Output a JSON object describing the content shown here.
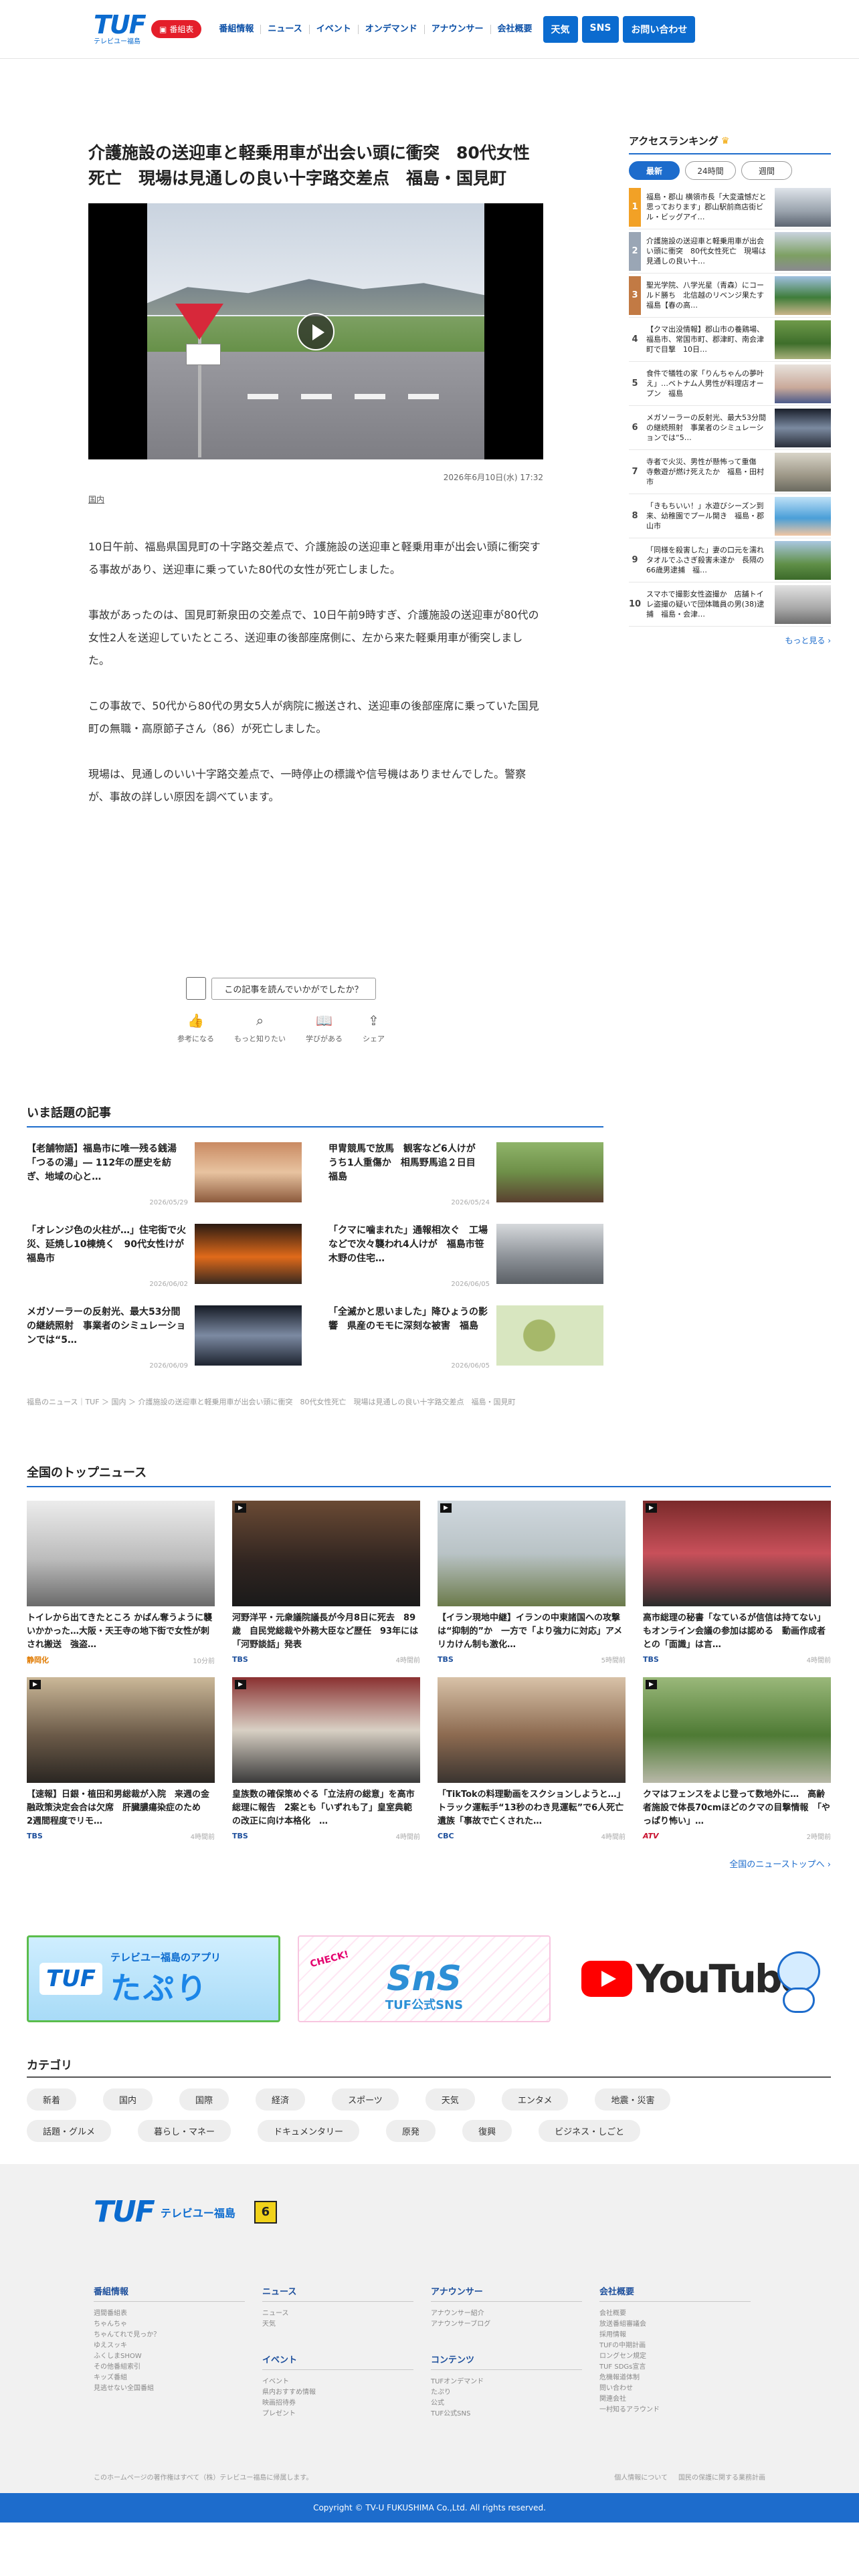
{
  "header": {
    "logo": "TUF",
    "logo_sub": "テレビユー福島",
    "badge": "番組表",
    "nav": [
      "番組情報",
      "ニュース",
      "イベント",
      "オンデマンド",
      "アナウンサー",
      "会社概要"
    ],
    "buttons": [
      "天気",
      "SNS",
      "お問い合わせ"
    ]
  },
  "article": {
    "title": "介護施設の送迎車と軽乗用車が出会い頭に衝突　80代女性死亡　現場は見通しの良い十字路交差点　福島・国見町",
    "date": "2026年6月10日(水) 17:32",
    "tag": "国内",
    "paragraphs": [
      "10日午前、福島県国見町の十字路交差点で、介護施設の送迎車と軽乗用車が出会い頭に衝突する事故があり、送迎車に乗っていた80代の女性が死亡しました。",
      "事故があったのは、国見町新泉田の交差点で、10日午前9時すぎ、介護施設の送迎車が80代の女性2人を送迎していたところ、送迎車の後部座席側に、左から来た軽乗用車が衝突しました。",
      "この事故で、50代から80代の男女5人が病院に搬送され、送迎車の後部座席に乗っていた国見町の無職・高原節子さん（86）が死亡しました。",
      "現場は、見通しのいい十字路交差点で、一時停止の標識や信号機はありませんでした。警察が、事故の詳しい原因を調べています。"
    ]
  },
  "survey": {
    "question": "この記事を読んでいかがでしたか？",
    "reactions": [
      "参考になる",
      "もっと知りたい",
      "学びがある",
      "シェア"
    ]
  },
  "ranking": {
    "heading": "アクセスランキング",
    "tabs": [
      "最新",
      "24時間",
      "週間"
    ],
    "items": [
      {
        "num": "1",
        "text": "福島・郡山 横領市長「大変遺憾だと思っております」郡山駅前商店街ビル・ビッグアイ…"
      },
      {
        "num": "2",
        "text": "介護施設の送迎車と軽乗用車が出会い頭に衝突　80代女性死亡　現場は見通しの良い十…"
      },
      {
        "num": "3",
        "text": "聖光学院、八学光星（青森）にコールド勝ち　北信越のリベンジ果たす　福島【春の高…"
      },
      {
        "num": "4",
        "text": "【クマ出没情報】郡山市の養鶏場、福島市、常国市町、郡津町、南会津町で目撃　10日…"
      },
      {
        "num": "5",
        "text": "食件で犠牲の家「りんちゃんの夢叶え」…ベトナム人男性が料理店オープン　福島"
      },
      {
        "num": "6",
        "text": "メガソーラーの反射光、最大53分間の継続照射　事業者のシミュレーションでは“5…"
      },
      {
        "num": "7",
        "text": "寺者で火災、男性が懸怖って重傷　寺敷遊が燃け死えたか　福島・田村市"
      },
      {
        "num": "8",
        "text": "「きもちいい！」水遊びシーズン到来、幼稚園でプール開き　福島・郡山市"
      },
      {
        "num": "9",
        "text": "「同様を殺害した」妻の口元を濡れタオルでふさぎ殺害未遂か　長隔の66歳男逮捕　福…"
      },
      {
        "num": "10",
        "text": "スマホで撮影女性盗撮か　店舗トイレ盗撮の疑いで団体職員の男(38)逮捕　福島・会津…"
      }
    ],
    "more": "もっと見る"
  },
  "hot": {
    "heading": "いま話題の記事",
    "items": [
      {
        "title": "【老舗物語】福島市に唯一残る銭湯「つるの湯」― 112年の歴史を紡ぎ、地域の心と…",
        "date": "2026/05/29"
      },
      {
        "title": "甲冑競馬で放馬　観客など6人けが　うち1人重傷か　相馬野馬追２日目　福島",
        "date": "2026/05/24"
      },
      {
        "title": "「オレンジ色の火柱が…」住宅街で火災、延焼し10棟焼く　90代女性けが　福島市",
        "date": "2026/06/02"
      },
      {
        "title": "「クマに噛まれた」通報相次ぐ　工場などで次々襲われ4人けが　福島市笹木野の住宅…",
        "date": "2026/06/05"
      },
      {
        "title": "メガソーラーの反射光、最大53分間の継続照射　事業者のシミュレーションでは“5…",
        "date": "2026/06/09"
      },
      {
        "title": "「全滅かと思いました」降ひょうの影響　県産のモモに深刻な被害　福島",
        "date": "2026/06/05"
      }
    ],
    "breadcrumb": "福島のニュース｜TUF ＞ 国内 ＞ 介護施設の送迎車と軽乗用車が出会い頭に衝突　80代女性死亡　現場は見通しの良い十字路交差点　福島・国見町"
  },
  "national": {
    "heading": "全国のトップニュース",
    "items": [
      {
        "title": "トイレから出てきたところ かばん奪うように襲いかかった…大阪・天王寺の地下街で女性が刺され搬送　強盗…",
        "source": "静岡化",
        "ago": "10分前",
        "video": false
      },
      {
        "title": "河野洋平・元衆議院議長が今月8日に死去　89歳　自民党総裁や外務大臣など歴任　93年には「河野談話」発表",
        "source": "TBS",
        "ago": "4時間前",
        "video": true
      },
      {
        "title": "【イラン現地中継】イランの中東諸国への攻撃は“抑制的”か　一方で「より強力に対応」アメリカけん制も激化…",
        "source": "TBS",
        "ago": "5時間前",
        "video": true
      },
      {
        "title": "高市総理の秘書「なているが信信は持てない」もオンライン会議の参加は認める　動画作成者との「面識」は言…",
        "source": "TBS",
        "ago": "4時間前",
        "video": true
      },
      {
        "title": "【速報】日銀・植田和男総裁が入院　来週の金融政策決定会合は欠席　肝臓膿瘍染症のため　2週間程度でリモ…",
        "source": "TBS",
        "ago": "4時間前",
        "video": true
      },
      {
        "title": "皇族数の確保策めぐる「立法府の総意」を高市総理に報告　2案とも「いずれも了」皇室典範の改正に向け本格化　…",
        "source": "TBS",
        "ago": "4時間前",
        "video": true
      },
      {
        "title": "「TikTokの料理動画をスクションしようと…」トラック運転手“13秒のわき見運転”で6人死亡 遺族「事故で亡くされた…",
        "source": "CBC",
        "ago": "4時間前",
        "video": false
      },
      {
        "title": "クマはフェンスをよじ登って数地外に…　高齢者施設で体長70cmほどのクマの目撃情報　「やっぱり怖い」…",
        "source": "ATV",
        "ago": "2時間前",
        "video": true
      }
    ],
    "more": "全国のニューストップへ"
  },
  "banners": {
    "app_small": "テレビユー福島のアプリ",
    "app_big": "たぷり",
    "sns_title": "SnS",
    "sns_sub": "TUF公式SNS",
    "sns_check": "CHECK!",
    "youtube": "YouTube"
  },
  "categories": {
    "heading": "カテゴリ",
    "items": [
      "新着",
      "国内",
      "国際",
      "経済",
      "スポーツ",
      "天気",
      "エンタメ",
      "地震・災害",
      "話題・グルメ",
      "暮らし・マネー",
      "ドキュメンタリー",
      "原発",
      "復興",
      "ビジネス・しごと"
    ]
  },
  "footer": {
    "logo": "TUF",
    "name": "テレビユー福島",
    "channel": "6",
    "cols": [
      {
        "heading": "番組情報",
        "links": [
          "週間番組表",
          "ちゃんちゃ",
          "ちゃんてれで見っか？",
          "ゆえスッキ",
          "ふくしまSHOW",
          "その他番組索引",
          "キッズ番組",
          "見逃せない全国番組"
        ]
      },
      {
        "heading": "ニュース",
        "links": [
          "ニュース",
          "天気"
        ],
        "heading2": "イベント",
        "links2": [
          "イベント",
          "県内おすすめ情報",
          "映画招待券",
          "プレゼント"
        ]
      },
      {
        "heading": "アナウンサー",
        "links": [
          "アナウンサー紹介",
          "アナウンサーブログ"
        ],
        "heading2": "コンテンツ",
        "links2": [
          "TUFオンデマンド",
          "たぷり",
          "公式",
          "TUF公式SNS"
        ]
      },
      {
        "heading": "会社概要",
        "links": [
          "会社概要",
          "放送番組審議会",
          "採用情報",
          "TUFの中期計画",
          "ロングセン規定",
          "TUF SDGs宣言",
          "危機報道体制",
          "問い合わせ",
          "関連会社",
          "一村知るアラウンド"
        ]
      }
    ],
    "note": "このホームページの著作権はすべて（株）テレビユー福島に帰属します。",
    "right_links": [
      "個人情報について",
      "国民の保護に関する業務計画"
    ],
    "copyright": "Copyright © TV-U FUKUSHIMA Co.,Ltd. All rights reserved."
  }
}
